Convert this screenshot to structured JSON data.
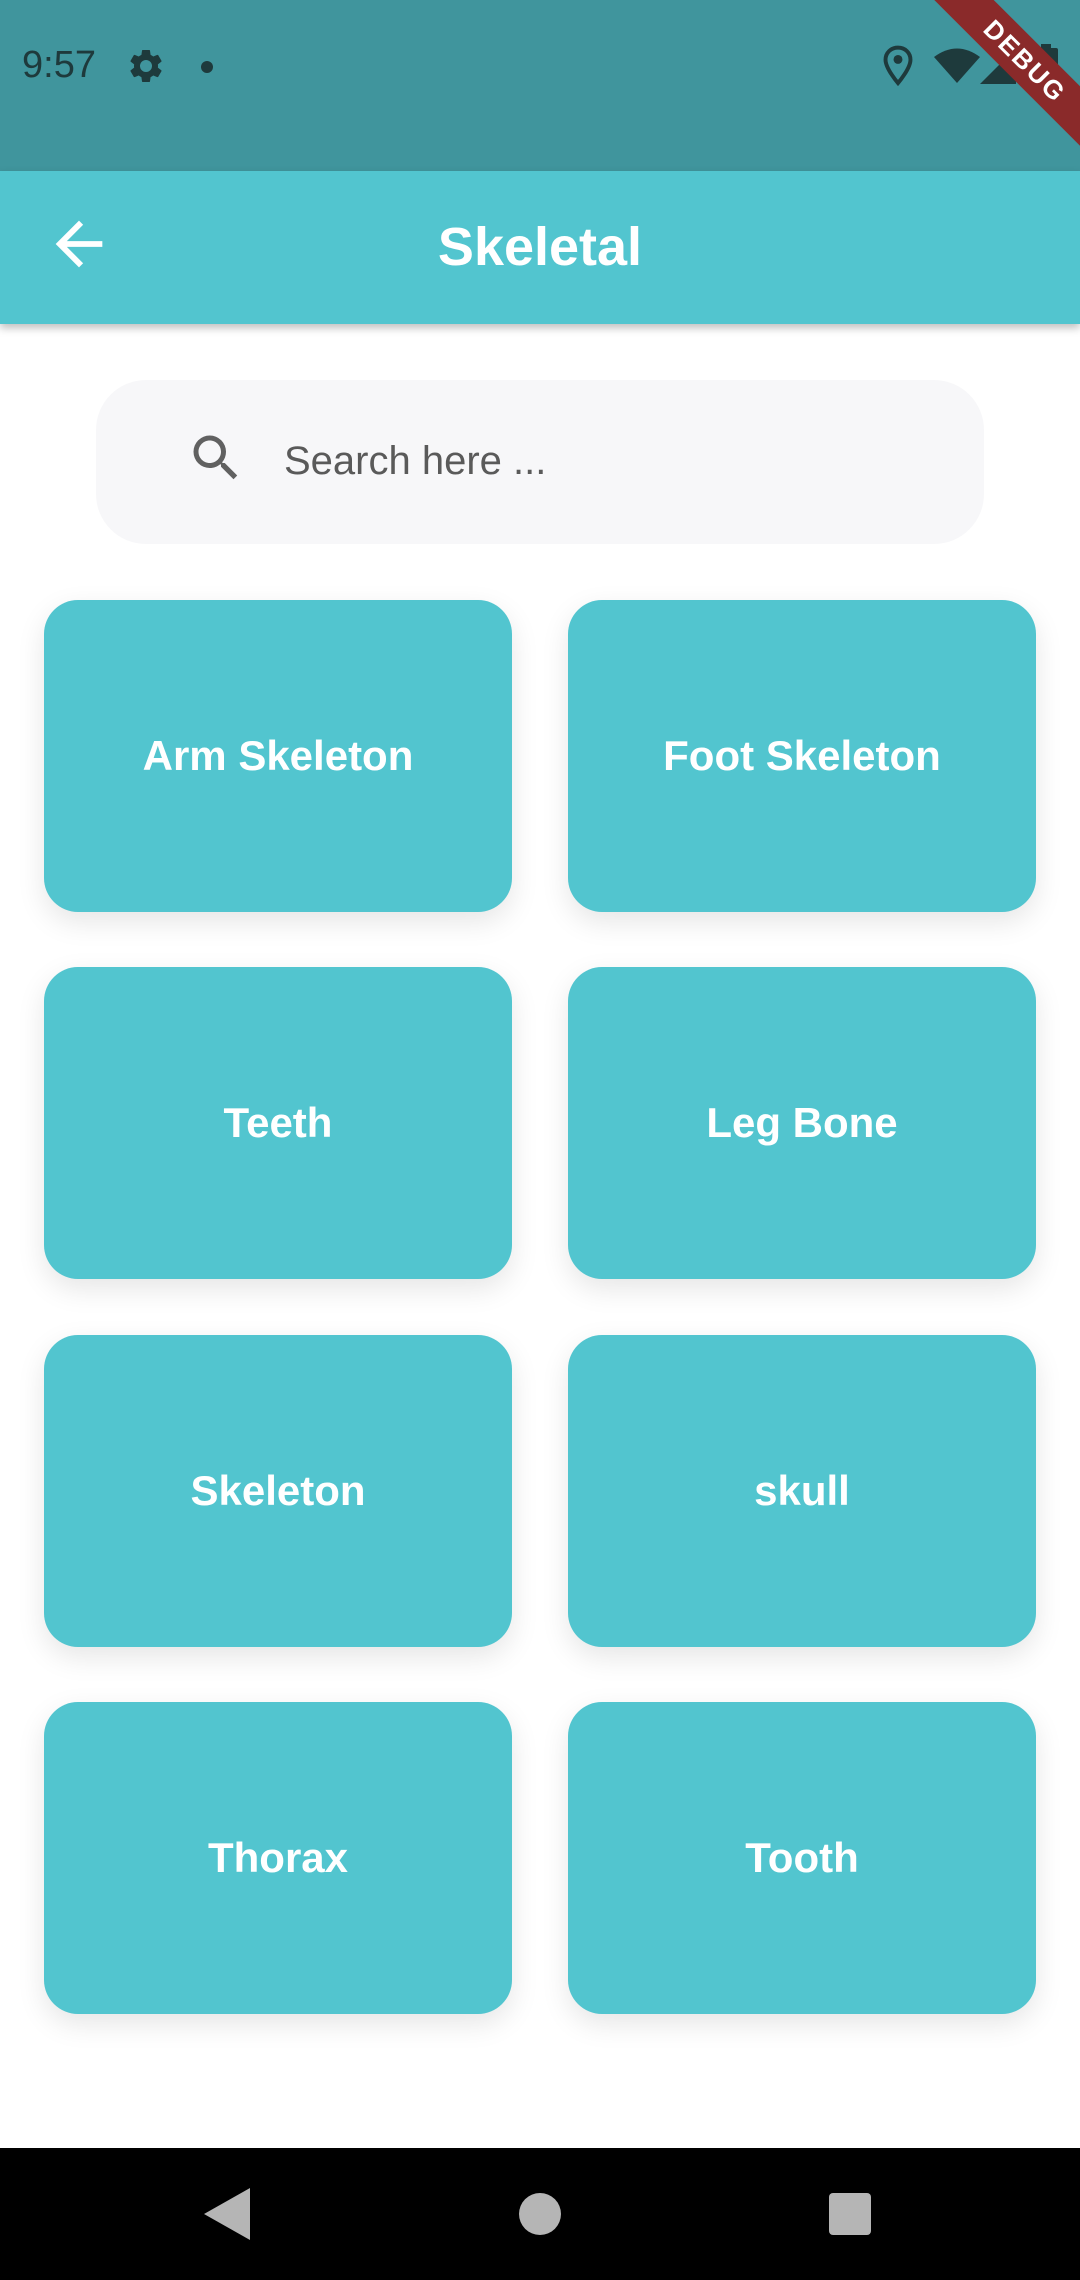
{
  "status_bar": {
    "time": "9:57",
    "debug_label": "DEBUG",
    "icons": [
      "gear-icon",
      "notification-dot-icon",
      "location-icon",
      "wifi-icon",
      "signal-icon",
      "battery-icon"
    ]
  },
  "app_bar": {
    "title": "Skeletal",
    "back_icon": "arrow-left-icon"
  },
  "search": {
    "placeholder": "Search here ...",
    "value": "",
    "icon": "search-icon"
  },
  "categories": [
    {
      "label": "Arm Skeleton"
    },
    {
      "label": "Foot Skeleton"
    },
    {
      "label": "Teeth"
    },
    {
      "label": "Leg Bone"
    },
    {
      "label": "Skeleton"
    },
    {
      "label": "skull"
    },
    {
      "label": "Thorax"
    },
    {
      "label": "Tooth"
    }
  ],
  "nav_bar": {
    "icons": [
      "nav-back-icon",
      "nav-home-icon",
      "nav-recents-icon"
    ]
  },
  "colors": {
    "status_bar": "#40959D",
    "app_bar": "#52C5CF",
    "card": "#52C5CF",
    "search_bg": "#F7F7F9",
    "nav_bar": "#000000",
    "debug_ribbon": "#8A2A2A"
  }
}
